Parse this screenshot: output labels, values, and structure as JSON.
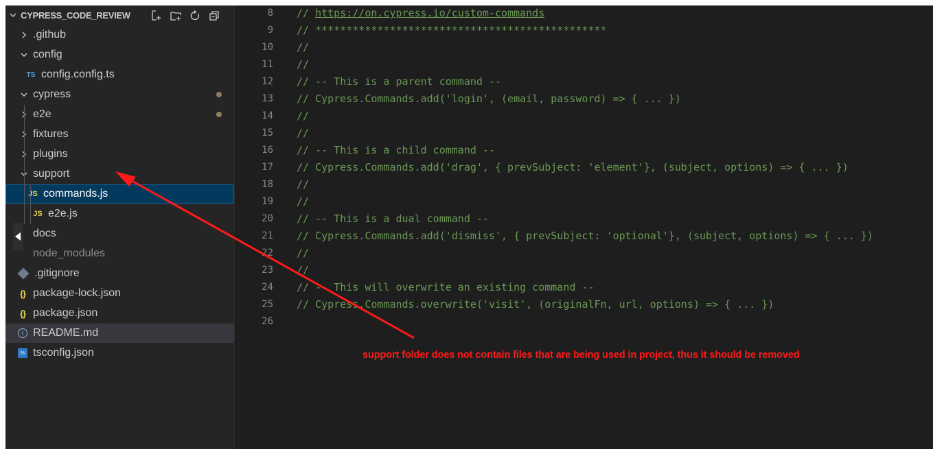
{
  "explorer": {
    "title": "CYPRESS_CODE_REVIEW",
    "actions": [
      {
        "name": "new-file-icon"
      },
      {
        "name": "new-folder-icon"
      },
      {
        "name": "refresh-icon"
      },
      {
        "name": "collapse-all-icon"
      }
    ],
    "items": [
      {
        "label": ".github",
        "type": "folder",
        "expanded": false
      },
      {
        "label": "config",
        "type": "folder",
        "expanded": true
      },
      {
        "label": "config.config.ts",
        "type": "ts",
        "icon": "TS"
      },
      {
        "label": "cypress",
        "type": "folder",
        "expanded": true,
        "modified": true
      },
      {
        "label": "e2e",
        "type": "folder",
        "expanded": false,
        "modified": true
      },
      {
        "label": "fixtures",
        "type": "folder",
        "expanded": false
      },
      {
        "label": "plugins",
        "type": "folder",
        "expanded": false
      },
      {
        "label": "support",
        "type": "folder",
        "expanded": true
      },
      {
        "label": "commands.js",
        "type": "js",
        "icon": "JS",
        "selected": true
      },
      {
        "label": "e2e.js",
        "type": "js",
        "icon": "JS"
      },
      {
        "label": "docs",
        "type": "folder"
      },
      {
        "label": "node_modules",
        "type": "folder",
        "dimmed": true
      },
      {
        "label": ".gitignore",
        "type": "git"
      },
      {
        "label": "package-lock.json",
        "type": "json",
        "icon": "{}"
      },
      {
        "label": "package.json",
        "type": "json",
        "icon": "{}"
      },
      {
        "label": "README.md",
        "type": "info",
        "icon": "i"
      },
      {
        "label": "tsconfig.json",
        "type": "tsconfig",
        "icon": "ts"
      }
    ]
  },
  "editor": {
    "lines": [
      {
        "number": "8",
        "text": "// ",
        "link": "https://on.cypress.io/custom-commands"
      },
      {
        "number": "9",
        "text": "// ***********************************************"
      },
      {
        "number": "10",
        "text": "//"
      },
      {
        "number": "11",
        "text": "//"
      },
      {
        "number": "12",
        "text": "// -- This is a parent command --"
      },
      {
        "number": "13",
        "text": "// Cypress.Commands.add('login', (email, password) => { ... })"
      },
      {
        "number": "14",
        "text": "//"
      },
      {
        "number": "15",
        "text": "//"
      },
      {
        "number": "16",
        "text": "// -- This is a child command --"
      },
      {
        "number": "17",
        "text": "// Cypress.Commands.add('drag', { prevSubject: 'element'}, (subject, options) => { ... })"
      },
      {
        "number": "18",
        "text": "//"
      },
      {
        "number": "19",
        "text": "//"
      },
      {
        "number": "20",
        "text": "// -- This is a dual command --"
      },
      {
        "number": "21",
        "text": "// Cypress.Commands.add('dismiss', { prevSubject: 'optional'}, (subject, options) => { ... })"
      },
      {
        "number": "22",
        "text": "//"
      },
      {
        "number": "23",
        "text": "//"
      },
      {
        "number": "24",
        "text": "// -- This will overwrite an existing command --"
      },
      {
        "number": "25",
        "text": "// Cypress.Commands.overwrite('visit', (originalFn, url, options) => { ... })"
      },
      {
        "number": "26",
        "text": ""
      }
    ]
  },
  "annotation": {
    "text": "support folder does not contain files that are being used in project, thus it should be removed",
    "color": "#ff1a1a"
  },
  "colors": {
    "comment": "#6a9955",
    "line_number": "#858585",
    "selected_bg": "#04395e",
    "selected_border": "#0e639c"
  }
}
